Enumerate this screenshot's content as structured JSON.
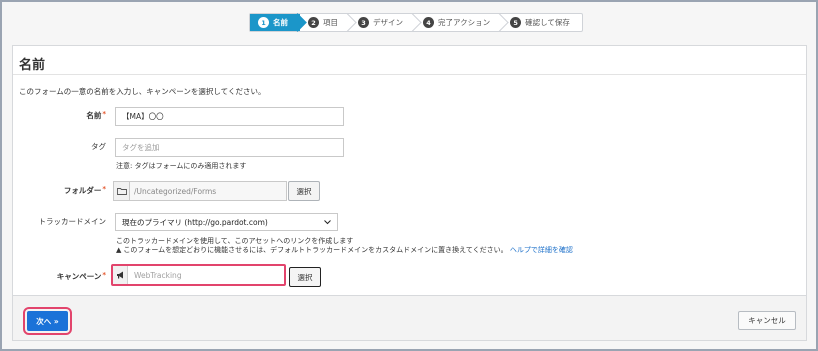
{
  "wizard": {
    "steps": [
      {
        "num": "1",
        "label": "名前"
      },
      {
        "num": "2",
        "label": "項目"
      },
      {
        "num": "3",
        "label": "デザイン"
      },
      {
        "num": "4",
        "label": "完了アクション"
      },
      {
        "num": "5",
        "label": "確認して保存"
      }
    ]
  },
  "panel": {
    "title": "名前",
    "intro": "このフォームの一意の名前を入力し、キャンペーンを選択してください。"
  },
  "form": {
    "name": {
      "label": "名前",
      "required": "*",
      "value": "【MA】〇〇"
    },
    "tags": {
      "label": "タグ",
      "placeholder": "タグを追加",
      "help": "注意: タグはフォームにのみ適用されます"
    },
    "folder": {
      "label": "フォルダー",
      "required": "*",
      "value": "/Uncategorized/Forms",
      "button": "選択"
    },
    "tracker": {
      "label": "トラッカードメイン",
      "selected": "現在のプライマリ (http://go.pardot.com)",
      "help1": "このトラッカードメインを使用して、このアセットへのリンクを作成します",
      "help2": "このフォームを想定どおりに機能させるには、デフォルトトラッカードメインをカスタムドメインに置き換えてください。",
      "help_link": "ヘルプで詳細を確認"
    },
    "campaign": {
      "label": "キャンペーン",
      "required": "*",
      "value": "WebTracking",
      "button": "選択"
    }
  },
  "footer": {
    "next": "次へ »",
    "cancel": "キャンセル"
  },
  "colors": {
    "accent": "#1b96c9",
    "primary_button": "#1b72d8",
    "highlight": "#e2446c"
  },
  "icons": {
    "folder": "folder-icon",
    "campaign": "megaphone-icon",
    "warning": "warning-icon",
    "dropdown": "chevron-down-icon"
  }
}
